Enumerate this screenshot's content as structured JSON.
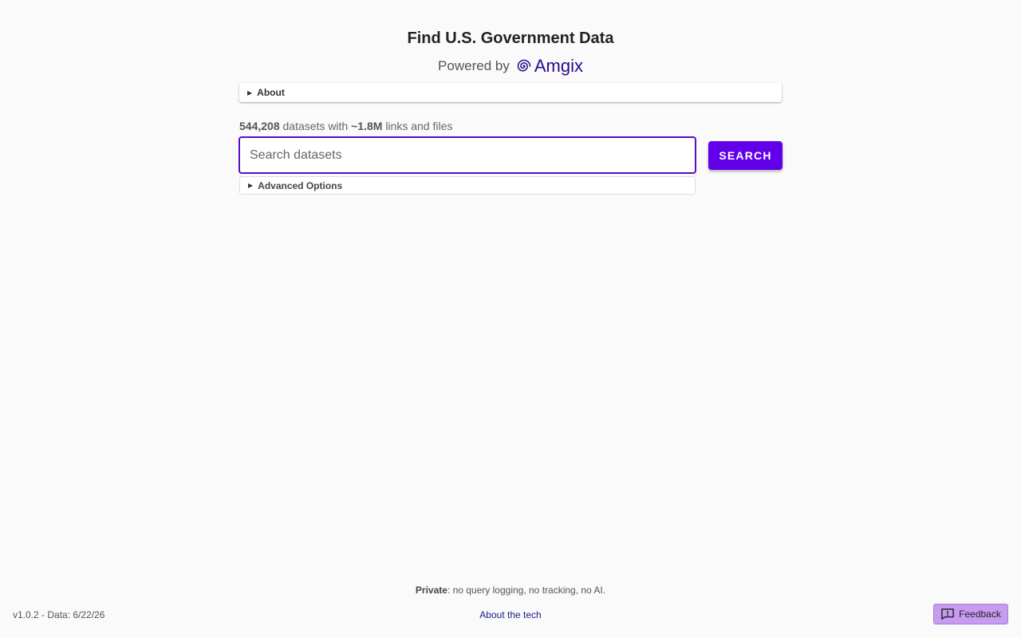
{
  "header": {
    "title": "Find U.S. Government Data",
    "powered_by": "Powered by",
    "brand_name": "Amgix",
    "brand_icon": "spiral-logo-icon",
    "brand_color": "#2a0a8c"
  },
  "about": {
    "label": "About"
  },
  "stats": {
    "dataset_count": "544,208",
    "datasets_with": "datasets with",
    "link_count": "~1.8M",
    "links_and_files": "links and files"
  },
  "search": {
    "placeholder": "Search datasets",
    "value": "",
    "button_label": "SEARCH",
    "accent_color": "#6200ea"
  },
  "advanced": {
    "label": "Advanced Options"
  },
  "footer": {
    "privacy_bold": "Private",
    "privacy_text": ": no query logging, no tracking, no AI.",
    "version": "v1.0.2 - Data: 6/22/26",
    "about_tech": "About the tech",
    "feedback_label": "Feedback",
    "feedback_icon": "feedback-icon"
  }
}
